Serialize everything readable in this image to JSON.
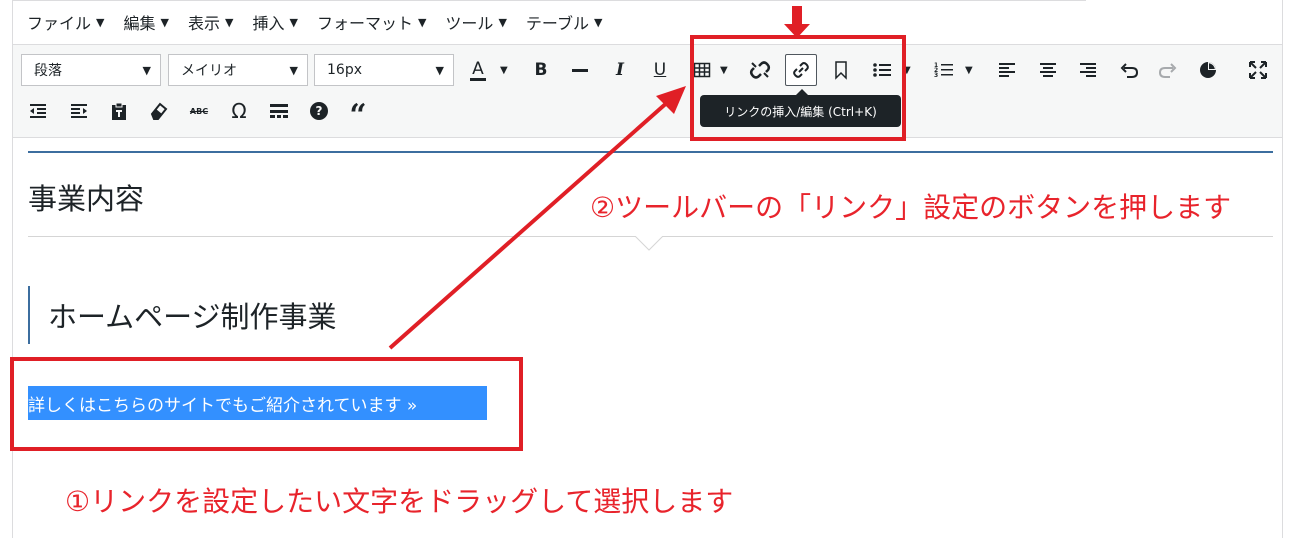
{
  "menubar": {
    "items": [
      "ファイル",
      "編集",
      "表示",
      "挿入",
      "フォーマット",
      "ツール",
      "テーブル"
    ]
  },
  "toolbar": {
    "paragraph_select": "段落",
    "font_select": "メイリオ",
    "size_select": "16px",
    "row1_buttons": [
      "text-color",
      "bold",
      "strikethrough",
      "italic",
      "underline",
      "table",
      "unlink",
      "link",
      "bookmark",
      "bullet-list",
      "numbered-list",
      "align-left",
      "align-center",
      "align-right",
      "undo",
      "redo",
      "pie-chart",
      "fullscreen"
    ],
    "row2_buttons": [
      "outdent",
      "indent",
      "paste-as-text",
      "clear-formatting",
      "spellcheck",
      "special-character",
      "horizontal-line",
      "help",
      "blockquote"
    ],
    "text_color_glyph": "A",
    "bold_glyph": "B",
    "italic_glyph": "I",
    "underline_glyph": "U",
    "omega_glyph": "Ω",
    "quote_glyph": "“",
    "help_glyph": "?",
    "abc_glyph": "ABC"
  },
  "tooltip": {
    "text": "リンクの挿入/編集 (Ctrl+K)"
  },
  "content": {
    "heading1": "事業内容",
    "heading2": "ホームページ制作事業",
    "selected_text": "詳しくはこちらのサイトでもご紹介されています »"
  },
  "annotations": {
    "step2": "②ツールバーの「リンク」設定のボタンを押します",
    "step1": "①リンクを設定したい文字をドラッグして選択します"
  },
  "colors": {
    "annotation_red": "#e01f26",
    "selection_blue": "#3390ff",
    "heading_border": "#3c6e9f"
  }
}
